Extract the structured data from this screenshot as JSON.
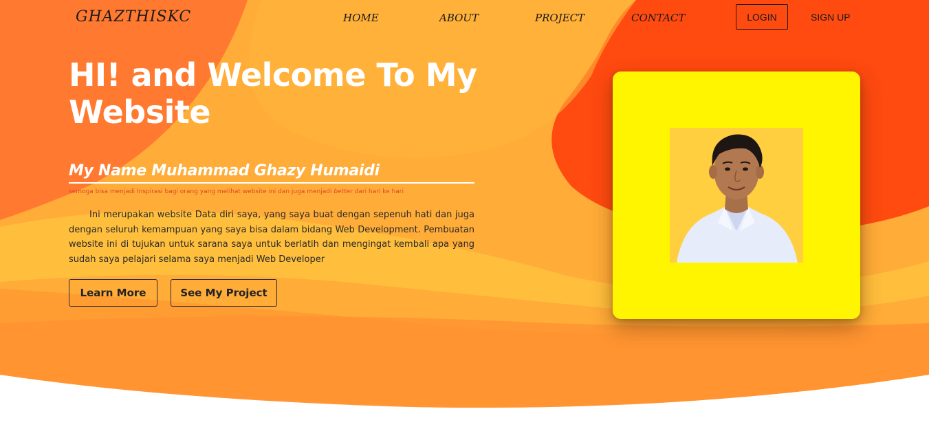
{
  "nav": {
    "brand": "GHAZTHISKC",
    "links": [
      "HOME",
      "ABOUT",
      "PROJECT",
      "CONTACT"
    ],
    "login_label": "LOGIN",
    "signup_label": "SIGN UP"
  },
  "hero": {
    "title": "HI! and Welcome To My Website",
    "name_heading": "My Name Muhammad Ghazy Humaidi",
    "tagline_before": "semoga bisa menjadi Inspirasi bagi orang yang melihat website ini dan juga menjadi ",
    "tagline_emphasis": "better",
    "tagline_after": " dari hari ke hari",
    "description": "Ini merupakan website Data diri saya, yang saya buat dengan sepenuh hati dan juga dengan seluruh kemampuan yang saya bisa dalam bidang Web Development. Pembuatan website ini di tujukan untuk sarana saya untuk berlatih dan mengingat kembali apa yang sudah saya pelajari selama saya menjadi Web Developer",
    "learn_more_label": "Learn More",
    "see_project_label": "See My Project"
  },
  "photo": {
    "icon": "profile-photo"
  },
  "colors": {
    "orange_dark": "#ff7a30",
    "orange_mid": "#ffac38",
    "orange_red": "#ff4a10",
    "yellow_card": "#fff500",
    "accent_text": "#e0442a"
  }
}
